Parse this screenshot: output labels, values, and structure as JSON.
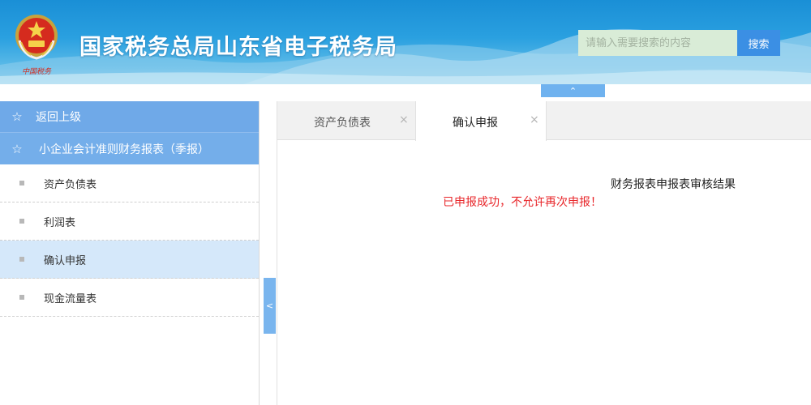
{
  "header": {
    "title": "国家税务总局山东省电子税务局",
    "emblem_caption": "中国税务",
    "search_placeholder": "请输入需要搜索的内容",
    "search_button": "搜索",
    "collapse_icon": "chevron-up"
  },
  "sidebar": {
    "back_label": "返回上级",
    "category_label": "小企业会计准则财务报表（季报）",
    "items": [
      {
        "label": "资产负债表",
        "active": false
      },
      {
        "label": "利润表",
        "active": false
      },
      {
        "label": "确认申报",
        "active": true
      },
      {
        "label": "现金流量表",
        "active": false
      }
    ],
    "toggle_icon": "chevron-left"
  },
  "tabs": [
    {
      "label": "资产负债表",
      "active": false,
      "close": "×"
    },
    {
      "label": "确认申报",
      "active": true,
      "close": "×"
    }
  ],
  "content": {
    "result_title": "财务报表申报表审核结果",
    "result_message": "已申报成功，不允许再次申报！"
  },
  "colors": {
    "header_blue": "#1a8fd6",
    "sidebar_blue": "#74aeea",
    "active_item": "#d5e8fa",
    "error_red": "#e8262a",
    "search_button": "#3b8fe4"
  }
}
